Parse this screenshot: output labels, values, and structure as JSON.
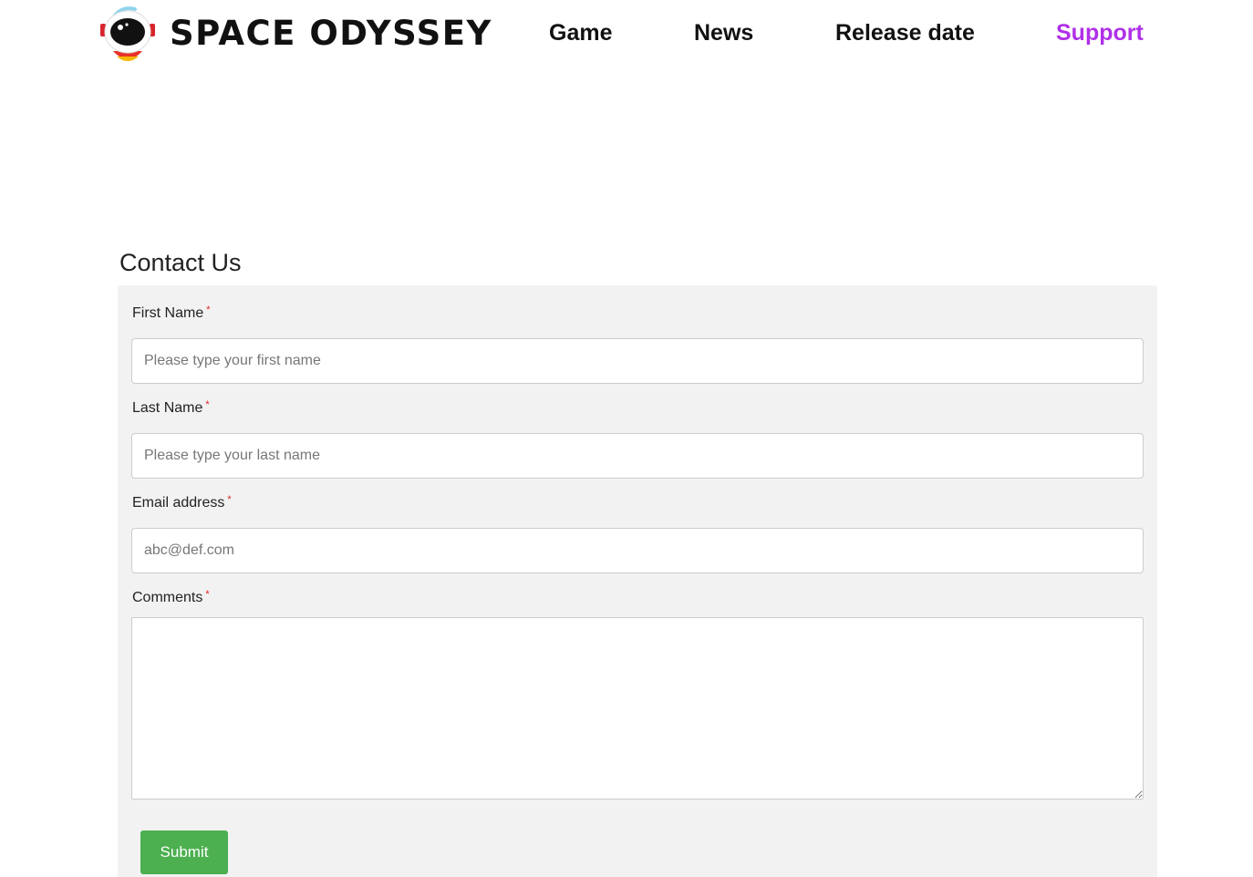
{
  "header": {
    "brand": "SPACE ODYSSEY",
    "logo_icon": "astronaut-helmet-icon",
    "nav": {
      "game": "Game",
      "news": "News",
      "release_date": "Release date",
      "support": "Support"
    },
    "active_color": "#b030e8"
  },
  "main": {
    "title": "Contact Us",
    "form": {
      "first_name": {
        "label": "First Name",
        "required_mark": "*",
        "placeholder": "Please type your first name",
        "value": ""
      },
      "last_name": {
        "label": "Last Name",
        "required_mark": "*",
        "placeholder": "Please type your last name",
        "value": ""
      },
      "email": {
        "label": "Email address",
        "required_mark": "*",
        "placeholder": "abc@def.com",
        "value": ""
      },
      "comments": {
        "label": "Comments",
        "required_mark": "*",
        "value": ""
      },
      "submit_label": "Submit",
      "submit_color": "#4caf50"
    }
  }
}
